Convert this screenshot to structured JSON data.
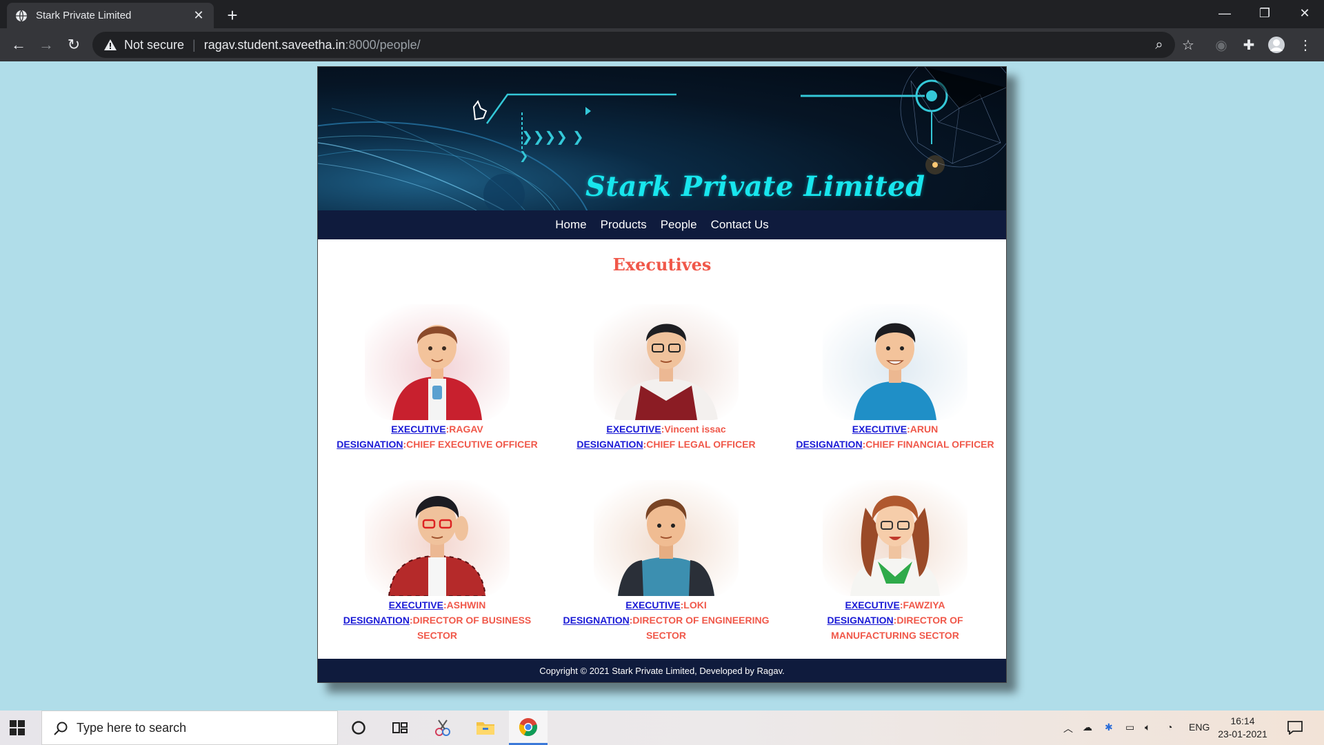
{
  "browser": {
    "tab_title": "Stark Private Limited",
    "security_label": "Not secure",
    "url_host": "ragav.student.saveetha.in",
    "url_rest": ":8000/people/"
  },
  "site": {
    "title": "Stark Private Limited",
    "nav": [
      "Home",
      "Products",
      "People",
      "Contact Us"
    ],
    "section_title": "Executives",
    "executive_key": "EXECUTIVE",
    "designation_key": "DESIGNATION",
    "people": [
      {
        "name": ":RAGAV",
        "designation": ":CHIEF EXECUTIVE OFFICER"
      },
      {
        "name": ":Vincent issac",
        "designation": ":CHIEF LEGAL OFFICER"
      },
      {
        "name": ":ARUN",
        "designation": ":CHIEF FINANCIAL OFFICER"
      },
      {
        "name": ":ASHWIN",
        "designation": ":DIRECTOR OF BUSINESS SECTOR"
      },
      {
        "name": ":LOKI",
        "designation": ":DIRECTOR OF ENGINEERING SECTOR"
      },
      {
        "name": ":FAWZIYA",
        "designation": ":DIRECTOR OF MANUFACTURING SECTOR"
      }
    ],
    "footer": "Copyright © 2021 Stark Private Limited, Developed by Ragav."
  },
  "taskbar": {
    "search_placeholder": "Type here to search",
    "language": "ENG",
    "time": "16:14",
    "date": "23-01-2021"
  },
  "colors": {
    "page_bg": "#b0dde9",
    "nav_bg": "#0f1b3d",
    "title_cyan": "#18e6ee",
    "accent_red": "#f0584a",
    "link_blue": "#1a1ad6"
  },
  "icons": [
    "globe-icon",
    "close-icon",
    "plus-icon",
    "back-arrow-icon",
    "forward-arrow-icon",
    "reload-icon",
    "warning-icon",
    "zoom-icon",
    "star-icon",
    "extensions-icon",
    "profile-icon",
    "menu-icon",
    "windows-icon",
    "search-icon",
    "cortana-icon",
    "task-view-icon",
    "chrome-icon",
    "notification-icon"
  ]
}
